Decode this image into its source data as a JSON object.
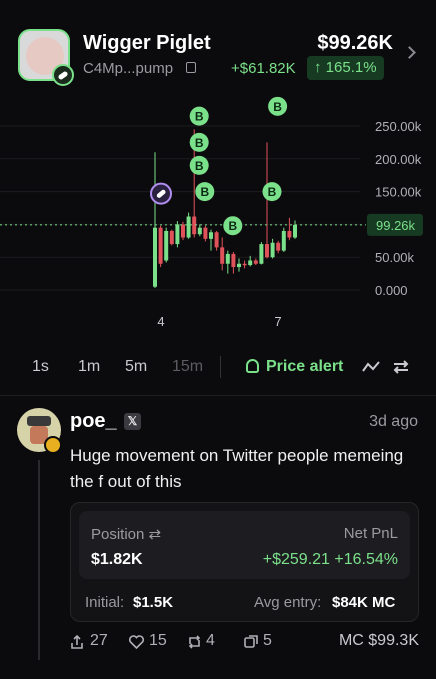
{
  "token": {
    "name": "Wigger Piglet",
    "address": "C4Mp...pump",
    "price": "$99.26K",
    "change_abs": "+$61.82K",
    "change_pct": "165.1%"
  },
  "chart": {
    "y_ticks": [
      "250.00k",
      "200.00k",
      "150.00k",
      "100.00k",
      "50.00k",
      "0.000"
    ],
    "current_label": "99.26k",
    "x_ticks": [
      "4",
      "7"
    ],
    "buy_marker": "B",
    "colors": {
      "up": "#7be08a",
      "down": "#e0525a",
      "accent": "#7be08a"
    }
  },
  "chart_data": {
    "type": "candlestick",
    "y_unit": "market cap",
    "ylim": [
      0,
      250000
    ],
    "current_price": 99260,
    "y_ticks": [
      0,
      50000,
      100000,
      150000,
      200000,
      250000
    ],
    "x_ticks": [
      "4",
      "7"
    ],
    "candles": [
      {
        "o": 5000,
        "c": 95000,
        "h": 210000,
        "l": 3000
      },
      {
        "o": 95000,
        "c": 40000,
        "h": 98000,
        "l": 35000
      },
      {
        "o": 45000,
        "c": 90000,
        "h": 95000,
        "l": 42000
      },
      {
        "o": 90000,
        "c": 70000,
        "h": 92000,
        "l": 68000
      },
      {
        "o": 70000,
        "c": 100000,
        "h": 105000,
        "l": 65000
      },
      {
        "o": 100000,
        "c": 80000,
        "h": 104000,
        "l": 76000
      },
      {
        "o": 80000,
        "c": 112000,
        "h": 118000,
        "l": 78000
      },
      {
        "o": 112000,
        "c": 85000,
        "h": 245000,
        "l": 80000
      },
      {
        "o": 85000,
        "c": 95000,
        "h": 100000,
        "l": 82000
      },
      {
        "o": 95000,
        "c": 78000,
        "h": 98000,
        "l": 74000
      },
      {
        "o": 78000,
        "c": 88000,
        "h": 92000,
        "l": 60000
      },
      {
        "o": 88000,
        "c": 65000,
        "h": 90000,
        "l": 60000
      },
      {
        "o": 65000,
        "c": 40000,
        "h": 80000,
        "l": 30000
      },
      {
        "o": 40000,
        "c": 55000,
        "h": 60000,
        "l": 25000
      },
      {
        "o": 55000,
        "c": 35000,
        "h": 58000,
        "l": 25000
      },
      {
        "o": 35000,
        "c": 40000,
        "h": 48000,
        "l": 28000
      },
      {
        "o": 40000,
        "c": 38000,
        "h": 45000,
        "l": 33000
      },
      {
        "o": 38000,
        "c": 45000,
        "h": 52000,
        "l": 36000
      },
      {
        "o": 45000,
        "c": 40000,
        "h": 48000,
        "l": 38000
      },
      {
        "o": 40000,
        "c": 70000,
        "h": 73000,
        "l": 39000
      },
      {
        "o": 70000,
        "c": 50000,
        "h": 225000,
        "l": 48000
      },
      {
        "o": 50000,
        "c": 72000,
        "h": 78000,
        "l": 48000
      },
      {
        "o": 72000,
        "c": 60000,
        "h": 75000,
        "l": 56000
      },
      {
        "o": 60000,
        "c": 90000,
        "h": 95000,
        "l": 58000
      },
      {
        "o": 90000,
        "c": 80000,
        "h": 110000,
        "l": 76000
      },
      {
        "o": 80000,
        "c": 99260,
        "h": 106000,
        "l": 78000
      }
    ],
    "buy_markers": [
      {
        "candle": 7,
        "price": 265000
      },
      {
        "candle": 7,
        "price": 225000
      },
      {
        "candle": 7,
        "price": 190000
      },
      {
        "candle": 8,
        "price": 150000
      },
      {
        "candle": 13,
        "price": 98000
      },
      {
        "candle": 20,
        "price": 150000
      },
      {
        "candle": 21,
        "price": 280000
      }
    ]
  },
  "timeframes": {
    "items": [
      "1s",
      "1m",
      "5m",
      "15m"
    ],
    "price_alert": "Price alert"
  },
  "post": {
    "username": "poe_",
    "x_badge": "𝕏",
    "time": "3d ago",
    "text": "Huge movement on Twitter people memeing the f out of this",
    "position_label": "Position",
    "position_value": "$1.82K",
    "pnl_label": "Net PnL",
    "pnl_value": "+$259.21 +16.54%",
    "initial_label": "Initial:",
    "initial_value": "$1.5K",
    "avg_label": "Avg entry:",
    "avg_value": "$84K MC",
    "replies": "27",
    "likes": "15",
    "reposts": "4",
    "quotes": "5",
    "mc": "MC $99.3K"
  }
}
